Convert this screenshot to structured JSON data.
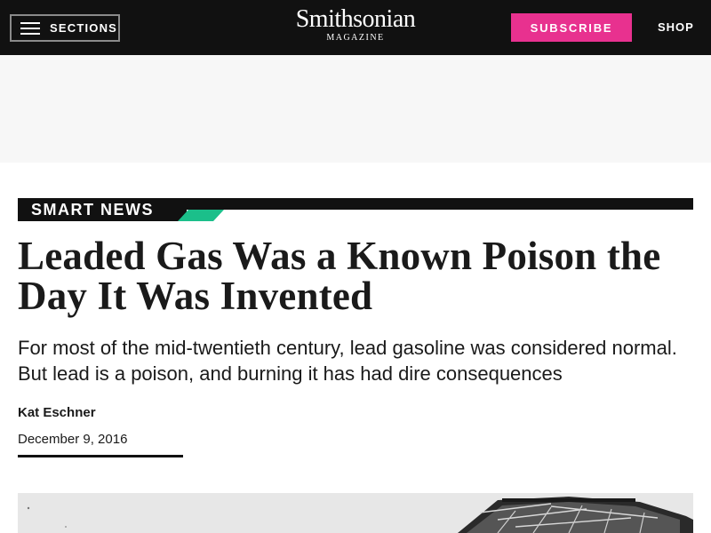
{
  "header": {
    "sections_label": "SECTIONS",
    "logo_main": "Smithsonian",
    "logo_sub": "MAGAZINE",
    "subscribe_label": "SUBSCRIBE",
    "shop_label": "SHOP"
  },
  "colors": {
    "topbar_bg": "#111111",
    "subscribe_bg": "#e8318f",
    "kicker_accent": "#1bbf8a"
  },
  "article": {
    "kicker": "SMART NEWS",
    "headline": "Leaded Gas Was a Known Poison the Day It Was Invented",
    "dek": "For most of the mid-twentieth century, lead gasoline was considered normal. But lead is a poison, and burning it has had dire consequences",
    "author": "Kat Eschner",
    "date": "December 9, 2016"
  },
  "icons": {
    "menu": "hamburger-icon"
  }
}
